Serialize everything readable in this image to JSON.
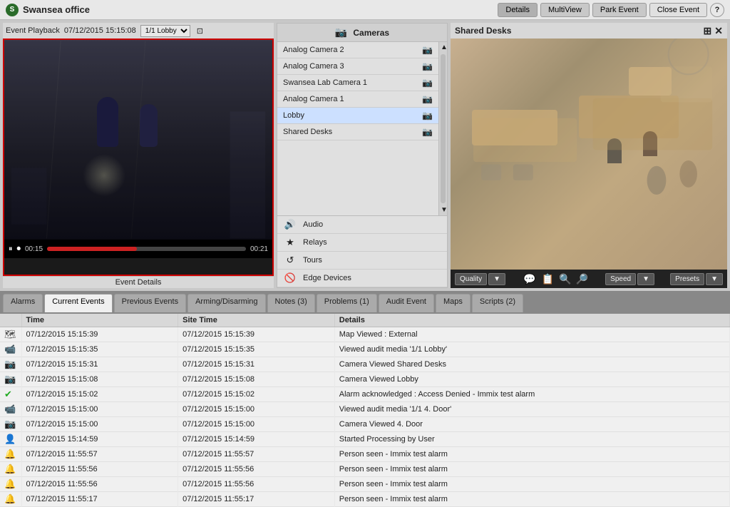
{
  "app": {
    "title": "Swansea office",
    "logo_char": "S"
  },
  "header_buttons": [
    {
      "label": "Details",
      "key": "details"
    },
    {
      "label": "MultiView",
      "key": "multiview"
    },
    {
      "label": "Park Event",
      "key": "park-event"
    },
    {
      "label": "Close Event",
      "key": "close-event"
    }
  ],
  "help_label": "?",
  "event_playback": {
    "label": "Event Playback",
    "datetime": "07/12/2015 15:15:08",
    "channel": "1/1 Lobby",
    "time_start": "00:15",
    "time_end": "00:21"
  },
  "event_details_label": "Event Details",
  "cameras_panel": {
    "header": "Cameras",
    "items": [
      {
        "name": "Analog Camera 2"
      },
      {
        "name": "Analog Camera 3"
      },
      {
        "name": "Swansea Lab Camera 1"
      },
      {
        "name": "Analog Camera 1"
      },
      {
        "name": "Lobby"
      },
      {
        "name": "Shared Desks"
      }
    ]
  },
  "bottom_controls": [
    {
      "icon": "🔊",
      "label": "Audio"
    },
    {
      "icon": "★",
      "label": "Relays"
    },
    {
      "icon": "↺",
      "label": "Tours"
    },
    {
      "icon": "🚫",
      "label": "Edge Devices"
    }
  ],
  "shared_desks": {
    "title": "Shared Desks"
  },
  "video_controls": {
    "quality_btn": "Quality",
    "speed_btn": "Speed",
    "presets_btn": "Presets"
  },
  "tabs": [
    {
      "label": "Alarms",
      "active": false
    },
    {
      "label": "Current Events",
      "active": true
    },
    {
      "label": "Previous Events",
      "active": false
    },
    {
      "label": "Arming/Disarming",
      "active": false
    },
    {
      "label": "Notes (3)",
      "active": false
    },
    {
      "label": "Problems (1)",
      "active": false
    },
    {
      "label": "Audit Event",
      "active": false
    },
    {
      "label": "Maps",
      "active": false
    },
    {
      "label": "Scripts (2)",
      "active": false
    }
  ],
  "events_table": {
    "columns": [
      "Time",
      "Site Time",
      "Details"
    ],
    "rows": [
      {
        "icon": "🗺",
        "icon_type": "icon-map",
        "time": "07/12/2015 15:15:39",
        "site_time": "07/12/2015 15:15:39",
        "details": "Map Viewed : External"
      },
      {
        "icon": "📹",
        "icon_type": "icon-view",
        "time": "07/12/2015 15:15:35",
        "site_time": "07/12/2015 15:15:35",
        "details": "Viewed audit media '1/1 Lobby'"
      },
      {
        "icon": "📷",
        "icon_type": "icon-camera",
        "time": "07/12/2015 15:15:31",
        "site_time": "07/12/2015 15:15:31",
        "details": "Camera Viewed Shared Desks"
      },
      {
        "icon": "📷",
        "icon_type": "icon-camera",
        "time": "07/12/2015 15:15:08",
        "site_time": "07/12/2015 15:15:08",
        "details": "Camera Viewed Lobby"
      },
      {
        "icon": "✔",
        "icon_type": "icon-alarm-ok",
        "time": "07/12/2015 15:15:02",
        "site_time": "07/12/2015 15:15:02",
        "details": "Alarm acknowledged : Access Denied - Immix test alarm"
      },
      {
        "icon": "📹",
        "icon_type": "icon-view",
        "time": "07/12/2015 15:15:00",
        "site_time": "07/12/2015 15:15:00",
        "details": "Viewed audit media '1/1 4. Door'"
      },
      {
        "icon": "📷",
        "icon_type": "icon-camera",
        "time": "07/12/2015 15:15:00",
        "site_time": "07/12/2015 15:15:00",
        "details": "Camera Viewed 4. Door"
      },
      {
        "icon": "👤",
        "icon_type": "icon-person",
        "time": "07/12/2015 15:14:59",
        "site_time": "07/12/2015 15:14:59",
        "details": "Started Processing by User"
      },
      {
        "icon": "🔔",
        "icon_type": "icon-alarm-red",
        "time": "07/12/2015 11:55:57",
        "site_time": "07/12/2015 11:55:57",
        "details": "Person seen - Immix test alarm"
      },
      {
        "icon": "🔔",
        "icon_type": "icon-alarm-red",
        "time": "07/12/2015 11:55:56",
        "site_time": "07/12/2015 11:55:56",
        "details": "Person seen - Immix test alarm"
      },
      {
        "icon": "🔔",
        "icon_type": "icon-alarm-red",
        "time": "07/12/2015 11:55:56",
        "site_time": "07/12/2015 11:55:56",
        "details": "Person seen - Immix test alarm"
      },
      {
        "icon": "🔔",
        "icon_type": "icon-alarm-red",
        "time": "07/12/2015 11:55:17",
        "site_time": "07/12/2015 11:55:17",
        "details": "Person seen - Immix test alarm"
      }
    ]
  }
}
